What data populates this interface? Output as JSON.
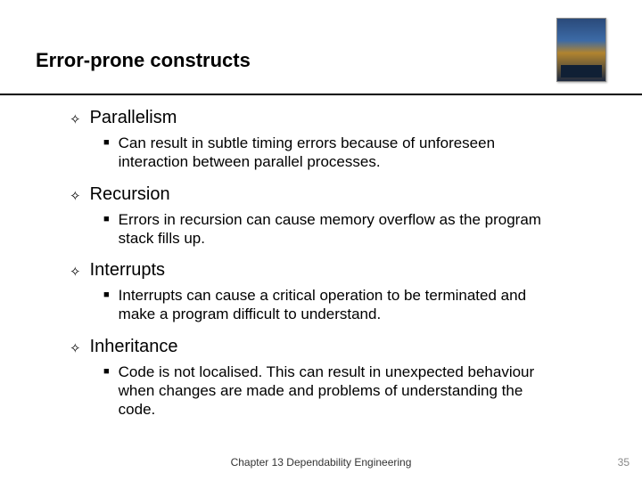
{
  "header": {
    "title": "Error-prone constructs"
  },
  "bullets": [
    {
      "label": "Parallelism",
      "sub": "Can result in subtle timing errors because of unforeseen interaction between parallel processes."
    },
    {
      "label": "Recursion",
      "sub": "Errors in recursion can cause memory overflow as the program stack fills up."
    },
    {
      "label": "Interrupts",
      "sub": "Interrupts can cause a critical operation to be terminated and make a program difficult to understand."
    },
    {
      "label": "Inheritance",
      "sub": "Code is not localised. This can result in unexpected behaviour when changes are made and problems of understanding the code."
    }
  ],
  "footer": {
    "center": "Chapter 13 Dependability Engineering",
    "page": "35"
  },
  "icons": {
    "diamond": "✧",
    "square": "■"
  }
}
